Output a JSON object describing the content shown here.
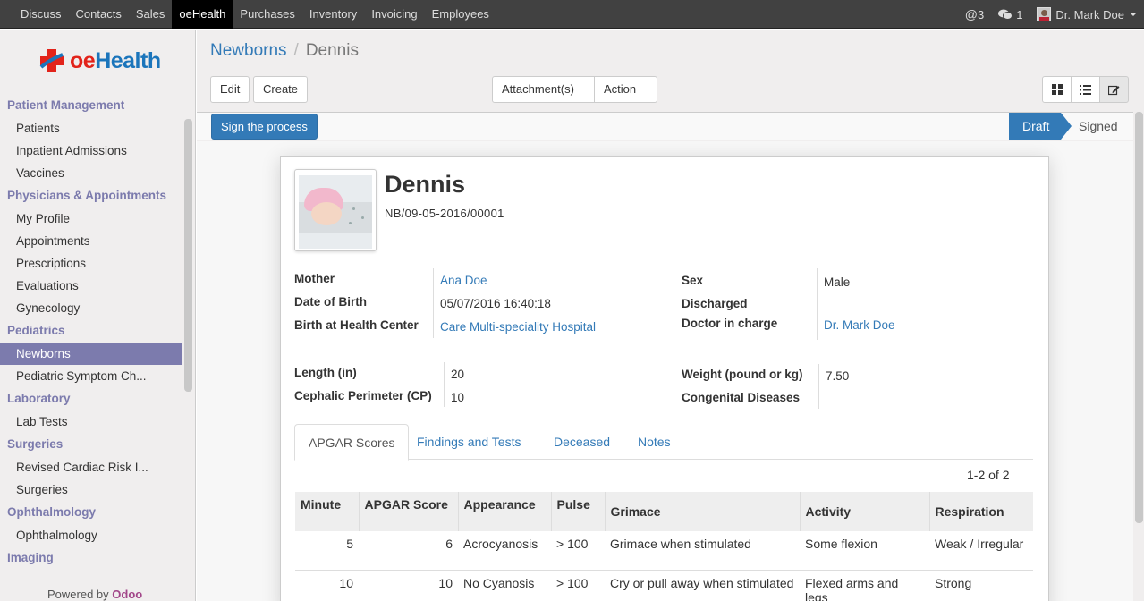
{
  "topbar": {
    "menu": [
      "Discuss",
      "Contacts",
      "Sales",
      "oeHealth",
      "Purchases",
      "Inventory",
      "Invoicing",
      "Employees"
    ],
    "active": "oeHealth",
    "mentions_count": "3",
    "messages_count": "1",
    "user_name": "Dr. Mark Doe"
  },
  "logo": {
    "brand_prefix": "oe",
    "brand_suffix": "Health"
  },
  "sidebar": {
    "sections": [
      {
        "title": "Patient Management",
        "items": [
          "Patients",
          "Inpatient Admissions",
          "Vaccines"
        ]
      },
      {
        "title": "Physicians & Appointments",
        "items": [
          "My Profile",
          "Appointments",
          "Prescriptions",
          "Evaluations",
          "Gynecology"
        ]
      },
      {
        "title": "Pediatrics",
        "items": [
          "Newborns",
          "Pediatric Symptom Ch..."
        ]
      },
      {
        "title": "Laboratory",
        "items": [
          "Lab Tests"
        ]
      },
      {
        "title": "Surgeries",
        "items": [
          "Revised Cardiac Risk I...",
          "Surgeries"
        ]
      },
      {
        "title": "Ophthalmology",
        "items": [
          "Ophthalmology"
        ]
      },
      {
        "title": "Imaging",
        "items": []
      }
    ],
    "active_item": "Newborns",
    "powered_by": "Powered by",
    "powered_brand": "Odoo"
  },
  "breadcrumb": {
    "parent": "Newborns",
    "current": "Dennis"
  },
  "toolbar": {
    "edit": "Edit",
    "create": "Create",
    "attachments": "Attachment(s)",
    "action": "Action"
  },
  "status": {
    "sign_button": "Sign the process",
    "stages": [
      "Draft",
      "Signed"
    ],
    "current": "Draft"
  },
  "record": {
    "name": "Dennis",
    "code": "NB/09-05-2016/00001",
    "fields": {
      "mother_label": "Mother",
      "mother": "Ana Doe",
      "dob_label": "Date of Birth",
      "dob": "05/07/2016 16:40:18",
      "birth_hc_label": "Birth at Health Center",
      "birth_hc": "Care Multi-speciality Hospital",
      "sex_label": "Sex",
      "sex": "Male",
      "discharged_label": "Discharged",
      "doctor_label": "Doctor in charge",
      "doctor": "Dr. Mark Doe",
      "length_label": "Length (in)",
      "length": "20",
      "cephalic_label": "Cephalic Perimeter (CP)",
      "cephalic": "10",
      "weight_label": "Weight (pound or kg)",
      "weight": "7.50",
      "congenital_label": "Congenital Diseases"
    }
  },
  "tabs": [
    "APGAR Scores",
    "Findings and Tests",
    "Deceased",
    "Notes"
  ],
  "active_tab": "APGAR Scores",
  "pager": "1-2 of 2",
  "apgar": {
    "headers": [
      "Minute",
      "APGAR Score",
      "Appearance",
      "Pulse",
      "Grimace",
      "Activity",
      "Respiration"
    ],
    "rows": [
      [
        "5",
        "6",
        "Acrocyanosis",
        "> 100",
        "Grimace when stimulated",
        "Some flexion",
        "Weak / Irregular"
      ],
      [
        "10",
        "10",
        "No Cyanosis",
        "> 100",
        "Cry or pull away when stimulated",
        "Flexed arms and legs",
        "Strong"
      ]
    ]
  }
}
